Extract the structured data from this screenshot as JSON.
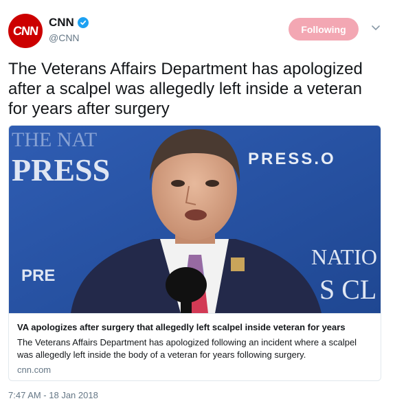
{
  "author": {
    "avatar_text": "CNN",
    "display_name": "CNN",
    "handle": "@CNN",
    "verified_icon": "verified-badge-icon"
  },
  "follow_button": {
    "label": "Following"
  },
  "menu": {
    "icon": "chevron-down-icon"
  },
  "tweet": {
    "text": "The Veterans Affairs Department has apologized after a scalpel was allegedly left inside a veteran for years after surgery"
  },
  "card": {
    "image_text": {
      "top_left_1": "THE NAT",
      "top_left_2": "PRESS",
      "top_right": "PRESS.O",
      "bottom_left": "PRE",
      "bottom_right_1": "NATIO",
      "bottom_right_2": "S CL"
    },
    "title": "VA apologizes after surgery that allegedly left scalpel inside veteran for years",
    "description": "The Veterans Affairs Department has apologized following an incident where a scalpel was allegedly left inside the body of a veteran for years following surgery.",
    "domain": "cnn.com"
  },
  "timestamp": "7:47 AM - 18 Jan 2018",
  "colors": {
    "brand_red": "#cc0000",
    "follow_pink": "#f3a7b3",
    "verified_blue": "#1da1f2",
    "backdrop_blue": "#2b56a8"
  }
}
